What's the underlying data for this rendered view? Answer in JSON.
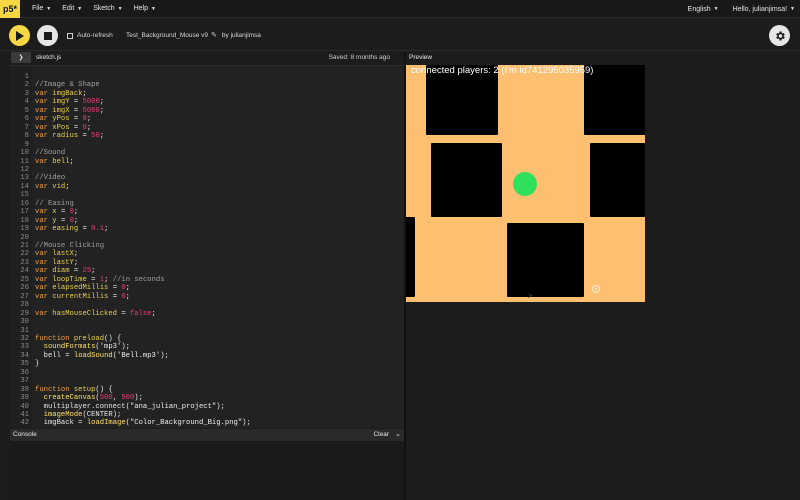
{
  "app": {
    "logo": "p5*"
  },
  "menubar": {
    "file": "File",
    "edit": "Edit",
    "sketch": "Sketch",
    "help": "Help",
    "language": "English",
    "user": "Hello, julianjimsa!"
  },
  "toolbar": {
    "auto_refresh": "Auto-refresh",
    "project_name": "Test_Background_Mouse v9",
    "byline": "by julianjimsa"
  },
  "editor": {
    "filename": "sketch.js",
    "saved": "Saved: 8 months ago"
  },
  "console": {
    "title": "Console",
    "clear": "Clear"
  },
  "preview": {
    "label": "Preview",
    "players_text": "connected players: 2 (I'm id741295035959)"
  },
  "colors": {
    "accent_yellow": "#f6d743",
    "canvas_bg": "#fec070",
    "ball": "#2ee05a",
    "keyword": "#f0a040",
    "number": "#ea3d76"
  },
  "code": [
    {
      "n": "1",
      "t": ""
    },
    {
      "n": "2",
      "t": "//Image & Shape"
    },
    {
      "n": "3",
      "t": "var imgBack;"
    },
    {
      "n": "4",
      "t": "var imgY = 5000;"
    },
    {
      "n": "5",
      "t": "var imgX = 5000;"
    },
    {
      "n": "6",
      "t": "var yPos = 0;"
    },
    {
      "n": "7",
      "t": "var xPos = 0;"
    },
    {
      "n": "8",
      "t": "var radius = 50;"
    },
    {
      "n": "9",
      "t": ""
    },
    {
      "n": "10",
      "t": "//Sound"
    },
    {
      "n": "11",
      "t": "var bell;"
    },
    {
      "n": "12",
      "t": ""
    },
    {
      "n": "13",
      "t": "//Video"
    },
    {
      "n": "14",
      "t": "var vid;"
    },
    {
      "n": "15",
      "t": ""
    },
    {
      "n": "16",
      "t": "// Easing"
    },
    {
      "n": "17",
      "t": "var x = 0;"
    },
    {
      "n": "18",
      "t": "var y = 0;"
    },
    {
      "n": "19",
      "t": "var easing = 0.1;"
    },
    {
      "n": "20",
      "t": ""
    },
    {
      "n": "21",
      "t": "//Mouse Clicking"
    },
    {
      "n": "22",
      "t": "var lastX;"
    },
    {
      "n": "23",
      "t": "var lastY;"
    },
    {
      "n": "24",
      "t": "var diam = 25;"
    },
    {
      "n": "25",
      "t": "var loopTime = 1; //in seconds"
    },
    {
      "n": "26",
      "t": "var elapsedMillis = 0;"
    },
    {
      "n": "27",
      "t": "var currentMillis = 0;"
    },
    {
      "n": "28",
      "t": ""
    },
    {
      "n": "29",
      "t": "var hasMouseClicked = false;"
    },
    {
      "n": "30",
      "t": ""
    },
    {
      "n": "31",
      "t": ""
    },
    {
      "n": "32",
      "t": "function preload() {"
    },
    {
      "n": "33",
      "t": "  soundFormats('mp3');"
    },
    {
      "n": "34",
      "t": "  bell = loadSound('Bell.mp3');"
    },
    {
      "n": "35",
      "t": "}"
    },
    {
      "n": "36",
      "t": ""
    },
    {
      "n": "37",
      "t": ""
    },
    {
      "n": "38",
      "t": "function setup() {"
    },
    {
      "n": "39",
      "t": "  createCanvas(500, 500);"
    },
    {
      "n": "40",
      "t": "  multiplayer.connect(\"ana_julian_project\");"
    },
    {
      "n": "41",
      "t": "  imageMode(CENTER);"
    },
    {
      "n": "42",
      "t": "  imgBack = loadImage(\"Color_Background_Big.png\");"
    }
  ]
}
